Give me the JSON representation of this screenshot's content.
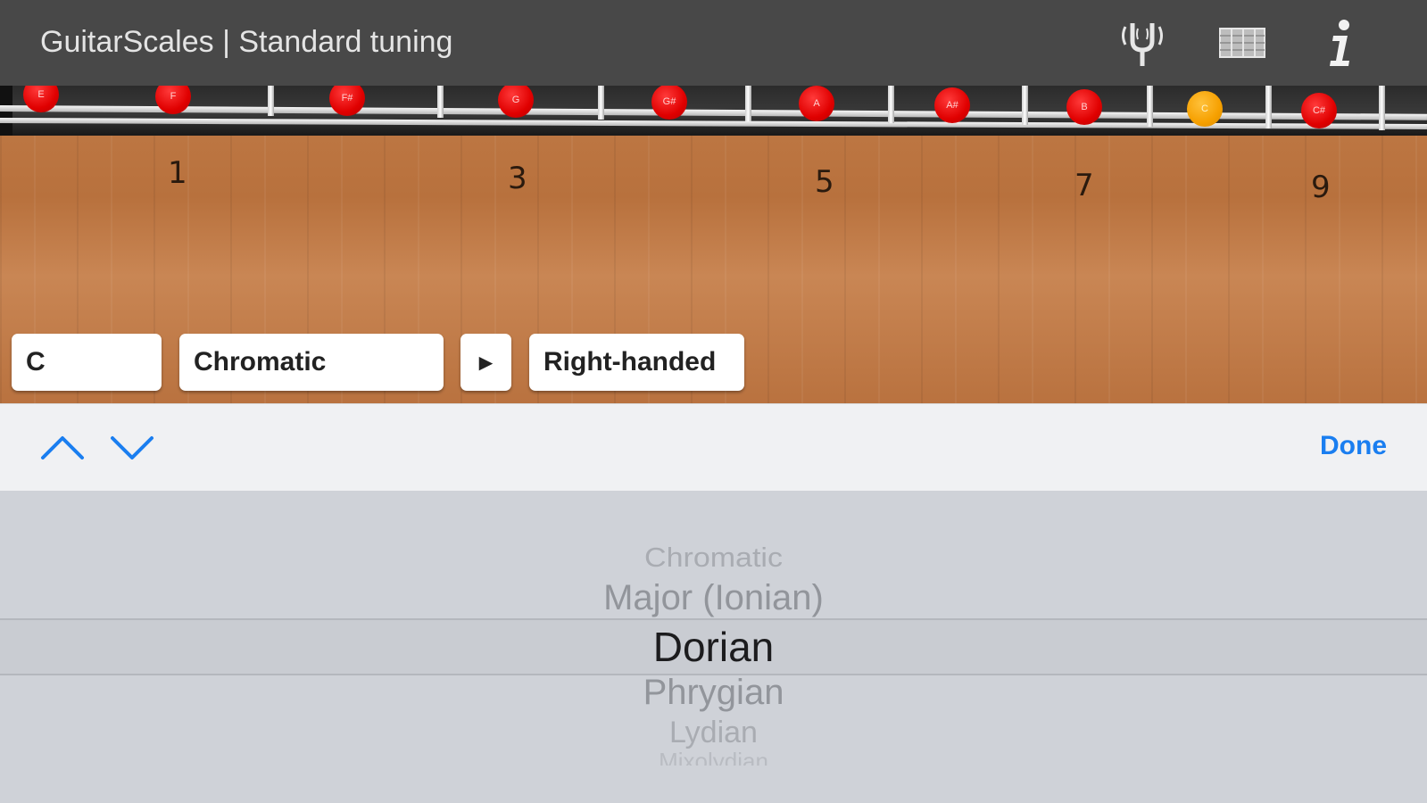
{
  "app": {
    "title": "GuitarScales | Standard tuning"
  },
  "toolbar": {
    "icons": [
      "tuning-fork-icon",
      "fretboard-view-icon",
      "info-icon"
    ]
  },
  "fretboard": {
    "open_string_notes": [
      "E",
      "F",
      "F#",
      "G",
      "G#",
      "A",
      "A#",
      "B",
      "C",
      "C#"
    ],
    "root_note": "C",
    "fret_markers": [
      "1",
      "3",
      "5",
      "7",
      "9"
    ],
    "colors": {
      "note": "#e00000",
      "root": "#f6a000",
      "wood": "#c07a46"
    }
  },
  "controls": {
    "key": "C",
    "scale": "Chromatic",
    "play_symbol": "►",
    "handedness": "Right-handed"
  },
  "accessory": {
    "previous_icon": "chevron-up-icon",
    "next_icon": "chevron-down-icon",
    "done_label": "Done",
    "accent": "#1a7ef0"
  },
  "picker": {
    "options": [
      "Chromatic",
      "Major (Ionian)",
      "Dorian",
      "Phrygian",
      "Lydian",
      "Mixolydian"
    ],
    "selected": "Dorian"
  }
}
